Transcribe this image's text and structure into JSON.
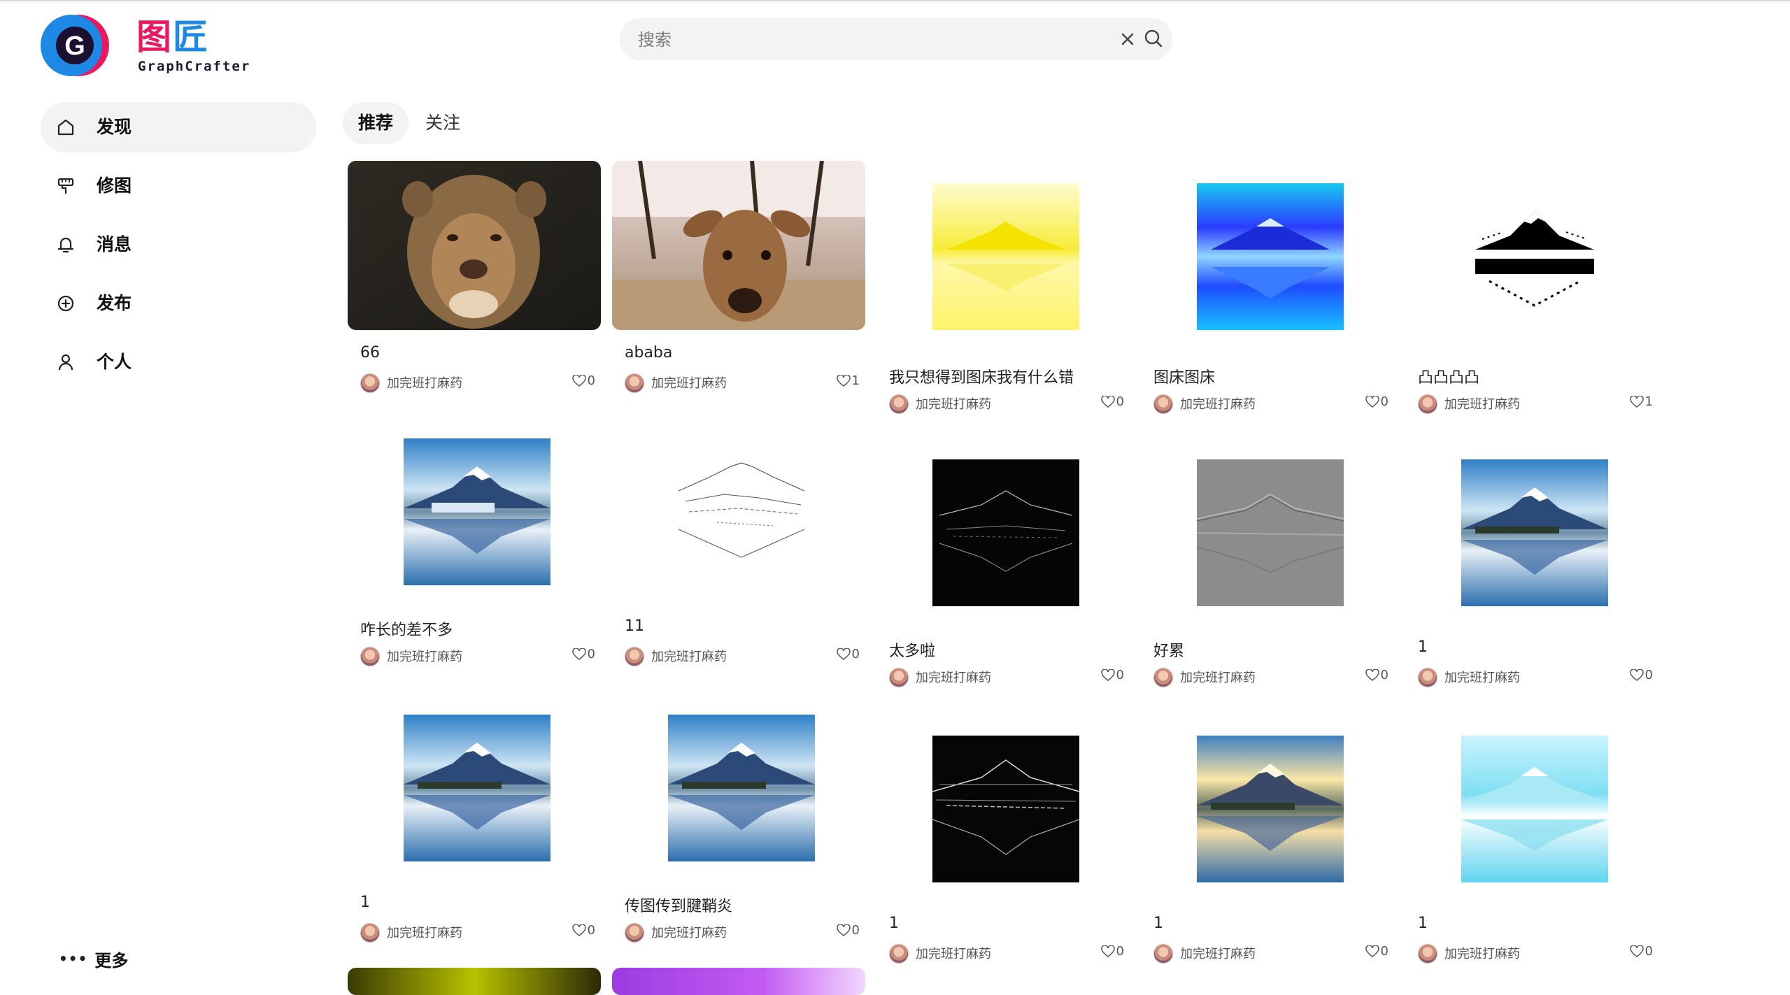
{
  "app": {
    "name_cn_part1": "图",
    "name_cn_part2": "匠",
    "name_en": "GraphCrafter",
    "logo_letter": "G"
  },
  "search": {
    "placeholder": "搜索"
  },
  "sidebar": {
    "items": [
      {
        "label": "发现",
        "icon": "home-icon",
        "active": true
      },
      {
        "label": "修图",
        "icon": "brush-icon",
        "active": false
      },
      {
        "label": "消息",
        "icon": "bell-icon",
        "active": false
      },
      {
        "label": "发布",
        "icon": "plus-circle-icon",
        "active": false
      },
      {
        "label": "个人",
        "icon": "user-icon",
        "active": false
      }
    ],
    "more_label": "更多"
  },
  "tabs": [
    {
      "label": "推荐",
      "active": true
    },
    {
      "label": "关注",
      "active": false
    }
  ],
  "cards": [
    {
      "title": "66",
      "author": "加完班打麻药",
      "likes": "0",
      "image": "lioness-photo"
    },
    {
      "title": "ababa",
      "author": "加完班打麻药",
      "likes": "1",
      "image": "deer-photo"
    },
    {
      "title": "我只想得到图床我有什么错",
      "author": "加完班打麻药",
      "likes": "0",
      "image": "mountain-yellow"
    },
    {
      "title": "图床图床",
      "author": "加完班打麻药",
      "likes": "0",
      "image": "mountain-blue"
    },
    {
      "title": "凸凸凸凸",
      "author": "加完班打麻药",
      "likes": "1",
      "image": "mountain-bw"
    },
    {
      "title": "咋长的差不多",
      "author": "加完班打麻药",
      "likes": "0",
      "image": "mountain-sparkle"
    },
    {
      "title": "11",
      "author": "加完班打麻药",
      "likes": "0",
      "image": "mountain-sketch"
    },
    {
      "title": "太多啦",
      "author": "加完班打麻药",
      "likes": "0",
      "image": "mountain-edges"
    },
    {
      "title": "好累",
      "author": "加完班打麻药",
      "likes": "0",
      "image": "mountain-emboss"
    },
    {
      "title": "1",
      "author": "加完班打麻药",
      "likes": "0",
      "image": "mountain-normal"
    },
    {
      "title": "1",
      "author": "加完班打麻药",
      "likes": "0",
      "image": "mountain-normal"
    },
    {
      "title": "传图传到腱鞘炎",
      "author": "加完班打麻药",
      "likes": "0",
      "image": "mountain-normal"
    },
    {
      "title": "1",
      "author": "加完班打麻药",
      "likes": "0",
      "image": "mountain-edges-2"
    },
    {
      "title": "1",
      "author": "加完班打麻药",
      "likes": "0",
      "image": "mountain-warm"
    },
    {
      "title": "1",
      "author": "加完班打麻药",
      "likes": "0",
      "image": "mountain-cyan"
    },
    {
      "title": "",
      "author": "",
      "likes": "",
      "image": "aurora-photo"
    },
    {
      "title": "",
      "author": "",
      "likes": "",
      "image": "purple-photo"
    }
  ],
  "colors": {
    "brand_pink": "#e8195f",
    "brand_blue": "#1e88e5",
    "nav_active_bg": "#f3f3f3"
  }
}
